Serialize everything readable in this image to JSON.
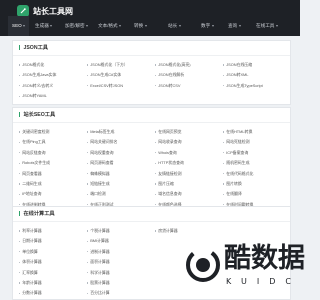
{
  "site": {
    "logo_text": "站长工具网"
  },
  "menu": [
    {
      "label": "SEO",
      "caret": true,
      "active": true
    },
    {
      "label": "生成器",
      "caret": true
    },
    {
      "label": "加密/解密",
      "caret": true
    },
    {
      "label": "文本/格式",
      "caret": true
    },
    {
      "label": "转换",
      "caret": true
    },
    {
      "label": "站长",
      "caret": true
    },
    {
      "label": "数字",
      "caret": true
    },
    {
      "label": "查询",
      "caret": true
    },
    {
      "label": "在线工具",
      "caret": true
    }
  ],
  "sections": [
    {
      "title": "JSON工具",
      "rows": [
        [
          "JSON格式化",
          "JSON格式化（下方）",
          "JSON格式化(高亮)",
          "JSON在线压缩"
        ],
        [
          "JSON生成Java实体",
          "JSON生成C#实体",
          "JSON在线解析",
          "JSON转XML"
        ],
        [
          "JSON转义/去转义",
          "Excel/CSV转JSON",
          "JSON转CSV",
          "JSON生成TypeScript"
        ],
        [
          "JSON转YAML",
          "",
          "",
          ""
        ]
      ]
    },
    {
      "title": "站长SEO工具",
      "rows": [
        [
          "关键词密度检测",
          "Meta标签生成",
          "在线网页预览",
          "在线HTML转换"
        ],
        [
          "在线Ping工具",
          "网站关键词排名",
          "网站收录查询",
          "网站死链检测"
        ],
        [
          "网站反链查询",
          "网站权重查询",
          "Whois查询",
          "ICP备案查询"
        ],
        [
          "Robots文件生成",
          "网页源码查看",
          "HTTP状态查询",
          "随机密码生成"
        ],
        [
          "网页查看器",
          "蜘蛛模拟器",
          "友情链接检测",
          "在线代码格式化"
        ],
        [
          "二维码生成",
          "短链接生成",
          "图片压缩",
          "图片转换"
        ],
        [
          "IP地址查询",
          "端口检测",
          "域名信息查询",
          "在线翻译"
        ],
        [
          "在线进制转换",
          "在线正则测试",
          "在线颜色选择",
          "在线时间戳转换"
        ],
        [
          "在线Base64",
          "在线MD5加密",
          "在线URL编码",
          "在线Unicode"
        ]
      ]
    },
    {
      "title": "在线计算工具",
      "rows": [
        [
          "利率计算器",
          "个税计算器",
          "房贷计算器",
          ""
        ],
        [
          "日期计算器",
          "BMI计算器",
          "",
          ""
        ],
        [
          "单位换算",
          "进制计算器",
          "",
          ""
        ],
        [
          "体积计算器",
          "面积计算器",
          "",
          ""
        ],
        [
          "汇率换算",
          "科学计算器",
          "",
          ""
        ],
        [
          "年龄计算器",
          "股票计算器",
          "",
          ""
        ],
        [
          "分数计算器",
          "百分比计算",
          "",
          ""
        ],
        [
          "平方根计算",
          "三角函数计算",
          "",
          ""
        ]
      ]
    }
  ],
  "watermark": {
    "text": "酷数据",
    "sub": "KUIDC"
  },
  "colors": {
    "topbar": "#1e2126",
    "accent": "#2fa36b",
    "background": "#eef1f4"
  }
}
